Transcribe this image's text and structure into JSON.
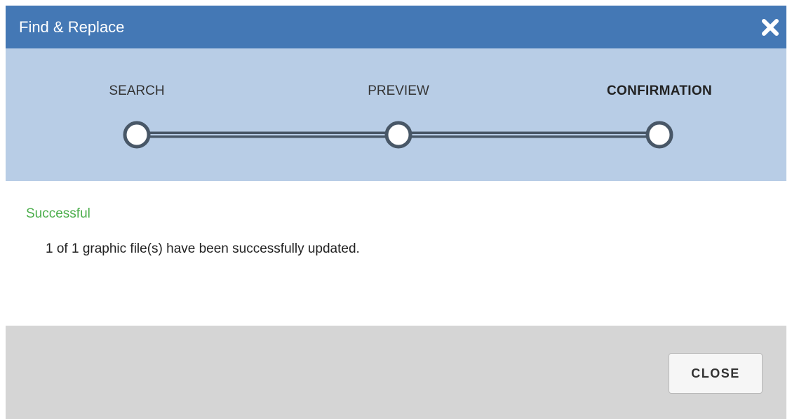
{
  "dialog": {
    "title": "Find & Replace",
    "close_icon": "close-x-icon"
  },
  "stepper": {
    "steps": [
      {
        "label": "SEARCH",
        "state": "completed"
      },
      {
        "label": "PREVIEW",
        "state": "completed"
      },
      {
        "label": "CONFIRMATION",
        "state": "active"
      }
    ],
    "colors": {
      "line": "#485767",
      "node_fill": "#ffffff"
    }
  },
  "result": {
    "status": "Successful",
    "message": "1 of 1 graphic file(s) have been successfully updated."
  },
  "footer": {
    "close_label": "CLOSE"
  },
  "colors": {
    "titlebar": "#4478b5",
    "stepper_bg": "#b8cde6",
    "success_text": "#4cae4c",
    "footer_bg": "#d5d5d5"
  }
}
